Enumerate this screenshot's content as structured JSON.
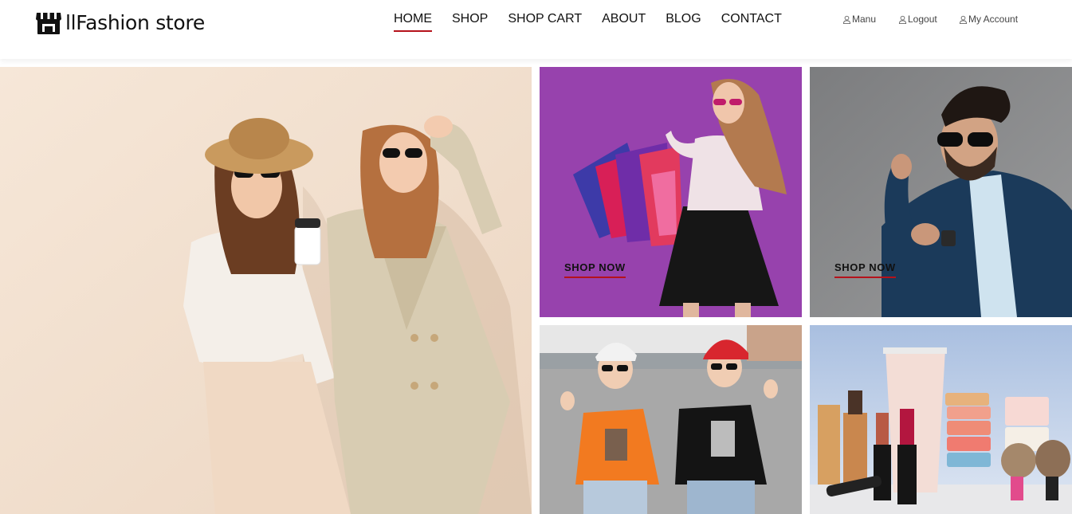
{
  "brand": {
    "name": "Fashion store",
    "icon": "storefront-icon"
  },
  "nav": {
    "items": [
      {
        "label": "HOME",
        "active": true
      },
      {
        "label": "SHOP",
        "active": false
      },
      {
        "label": "SHOP CART",
        "active": false
      },
      {
        "label": "ABOUT",
        "active": false
      },
      {
        "label": "BLOG",
        "active": false
      },
      {
        "label": "CONTACT",
        "active": false
      }
    ]
  },
  "account_links": [
    {
      "label": "Manu",
      "icon": "user-icon"
    },
    {
      "label": "Logout",
      "icon": "user-icon"
    },
    {
      "label": "My Account",
      "icon": "user-icon"
    }
  ],
  "tiles": {
    "women_promo": {
      "cta": "SHOP NOW",
      "image": "woman-with-shopping-bags"
    },
    "men_promo": {
      "cta": "SHOP NOW",
      "image": "man-in-suit-sunglasses"
    },
    "hero": {
      "image": "two-women-in-sunlight"
    },
    "kids": {
      "image": "two-boys-in-caps"
    },
    "cosmetics": {
      "image": "cosmetics-products"
    }
  },
  "colors": {
    "accent": "#b5121b",
    "women_bg": "#9b44b0",
    "men_bg": "#878889"
  }
}
